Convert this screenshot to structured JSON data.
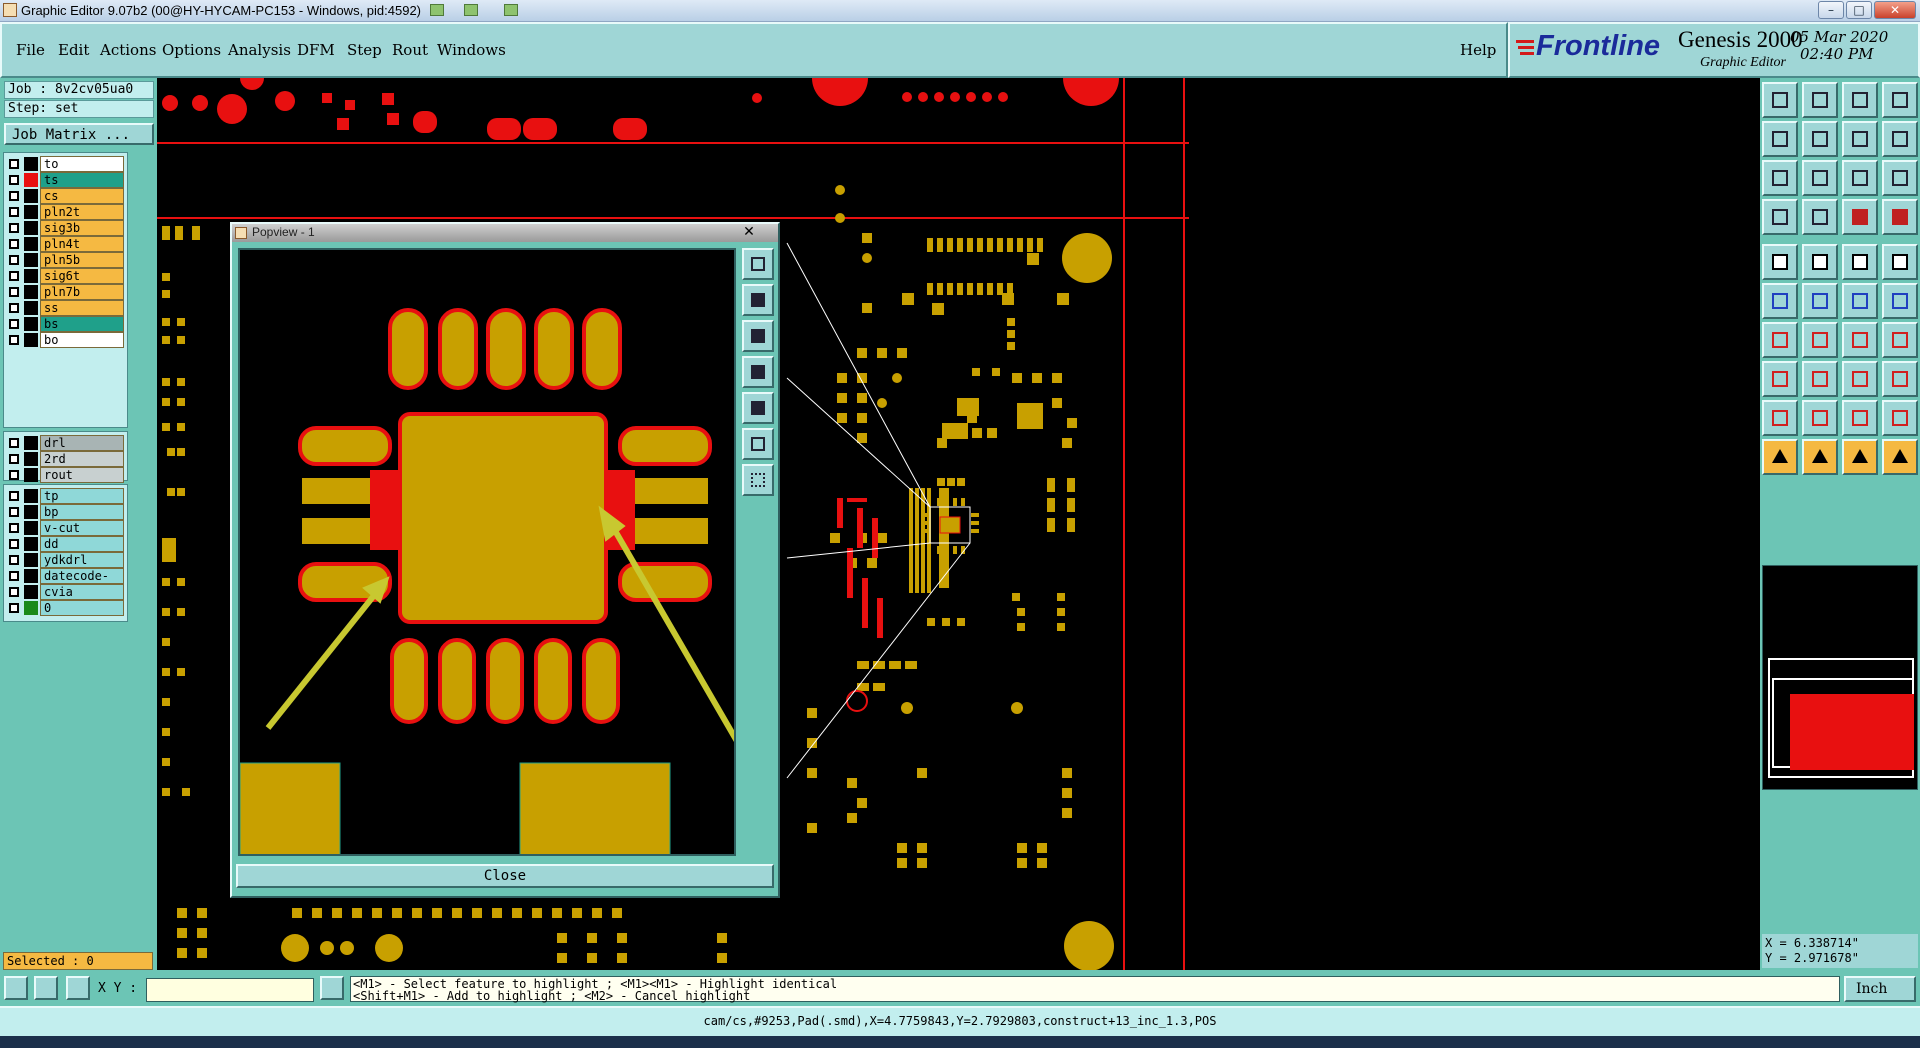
{
  "window": {
    "title": "Graphic Editor 9.07b2 (00@HY-HYCAM-PC153 - Windows, pid:4592)"
  },
  "menu": {
    "items": [
      "File",
      "Edit",
      "Actions",
      "Options",
      "Analysis",
      "DFM",
      "Step",
      "Rout",
      "Windows"
    ],
    "help": "Help"
  },
  "brand": {
    "logo_text": "Frontline",
    "product": "Genesis 2000",
    "subtitle": "Graphic Editor",
    "date": "05 Mar 2020",
    "time": "02:40 PM"
  },
  "job": {
    "job_label": "Job : 8v2cv05ua0",
    "step_label": "Step: set",
    "matrix_button": "Job Matrix ..."
  },
  "layers": {
    "board": [
      {
        "name": "to",
        "color": "#ffffff",
        "swatch": "#000000"
      },
      {
        "name": "ts",
        "color": "#1fa08a",
        "swatch": "#e81010"
      },
      {
        "name": "cs",
        "color": "#f5b942",
        "swatch": "#000000"
      },
      {
        "name": "pln2t",
        "color": "#f5b942",
        "swatch": "#000000"
      },
      {
        "name": "sig3b",
        "color": "#f5b942",
        "swatch": "#000000"
      },
      {
        "name": "pln4t",
        "color": "#f5b942",
        "swatch": "#000000"
      },
      {
        "name": "pln5b",
        "color": "#f5b942",
        "swatch": "#000000"
      },
      {
        "name": "sig6t",
        "color": "#f5b942",
        "swatch": "#000000"
      },
      {
        "name": "pln7b",
        "color": "#f5b942",
        "swatch": "#000000"
      },
      {
        "name": "ss",
        "color": "#f5b942",
        "swatch": "#000000"
      },
      {
        "name": "bs",
        "color": "#1fa08a",
        "swatch": "#000000"
      },
      {
        "name": "bo",
        "color": "#ffffff",
        "swatch": "#000000"
      }
    ],
    "drill": [
      {
        "name": "drl",
        "color": "#a8b4b4",
        "swatch": "#000000"
      },
      {
        "name": "2rd",
        "color": "#c8d0d0",
        "swatch": "#000000"
      },
      {
        "name": "rout",
        "color": "#c8d0d0",
        "swatch": "#000000"
      }
    ],
    "misc": [
      {
        "name": "tp",
        "color": "#8fd8d8",
        "swatch": "#000000"
      },
      {
        "name": "bp",
        "color": "#8fd8d8",
        "swatch": "#000000"
      },
      {
        "name": "v-cut",
        "color": "#8fd8d8",
        "swatch": "#000000"
      },
      {
        "name": "dd",
        "color": "#8fd8d8",
        "swatch": "#000000"
      },
      {
        "name": "ydkdrl",
        "color": "#8fd8d8",
        "swatch": "#000000"
      },
      {
        "name": "datecode-ts",
        "color": "#8fd8d8",
        "swatch": "#000000"
      },
      {
        "name": "cvia",
        "color": "#8fd8d8",
        "swatch": "#000000"
      },
      {
        "name": "0",
        "color": "#8fd8d8",
        "swatch": "#1a8a1a"
      }
    ]
  },
  "selected": "Selected : 0",
  "popview": {
    "title": "Popview - 1",
    "close_label": "Close"
  },
  "coords": {
    "x": "X = 6.338714\"",
    "y": "Y = 2.971678\""
  },
  "bottom": {
    "xy_label": "X Y :",
    "xy_value": "",
    "hint1": "<M1> - Select feature to highlight ; <M1><M1> - Highlight identical",
    "hint2": "<Shift+M1> - Add to highlight ; <M2> - Cancel highlight",
    "units": "Inch"
  },
  "status": {
    "text": "cam/cs,#9253,Pad(.smd),X=4.7759843,Y=2.7929803,construct+13_inc_1.3,POS"
  },
  "colors": {
    "panel": "#6cc5b5",
    "menu": "#9fd6d6",
    "copper": "#c8a000",
    "mask": "#e81010",
    "arrow": "#c8c830"
  }
}
